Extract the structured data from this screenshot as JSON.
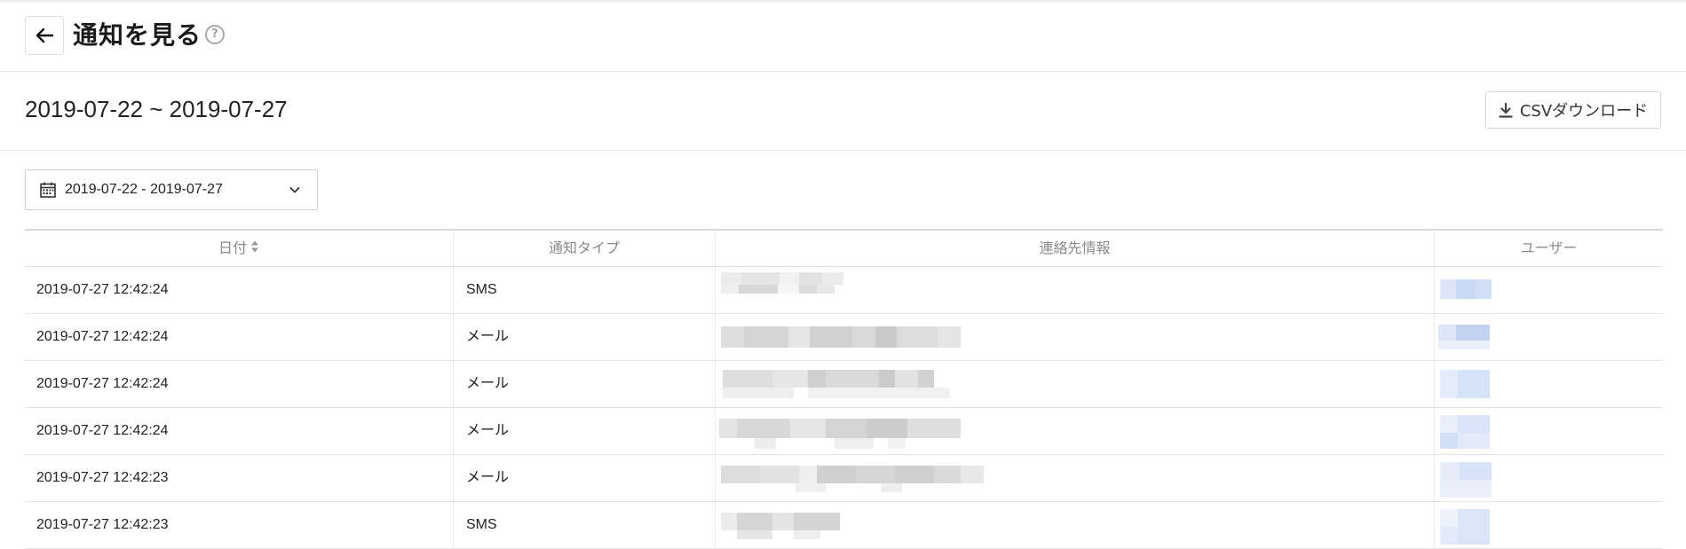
{
  "header": {
    "title": "通知を見る",
    "back_icon": "arrow-left-icon",
    "help_symbol": "?"
  },
  "range": {
    "heading": "2019-07-22 ~ 2019-07-27",
    "csv_button_label": "CSVダウンロード"
  },
  "date_picker": {
    "value": "2019-07-22 - 2019-07-27"
  },
  "table": {
    "columns": [
      "日付",
      "通知タイプ",
      "連絡先情報",
      "ユーザー"
    ],
    "rows": [
      {
        "date": "2019-07-27 12:42:24",
        "type": "SMS"
      },
      {
        "date": "2019-07-27 12:42:24",
        "type": "メール"
      },
      {
        "date": "2019-07-27 12:42:24",
        "type": "メール"
      },
      {
        "date": "2019-07-27 12:42:24",
        "type": "メール"
      },
      {
        "date": "2019-07-27 12:42:23",
        "type": "メール"
      },
      {
        "date": "2019-07-27 12:42:23",
        "type": "SMS"
      }
    ]
  },
  "colors": {
    "border": "#e4e4e4",
    "header_text": "#8a8a8a",
    "redaction_gray": "#d0d0d0",
    "redaction_blue": "#c9d8f3"
  }
}
